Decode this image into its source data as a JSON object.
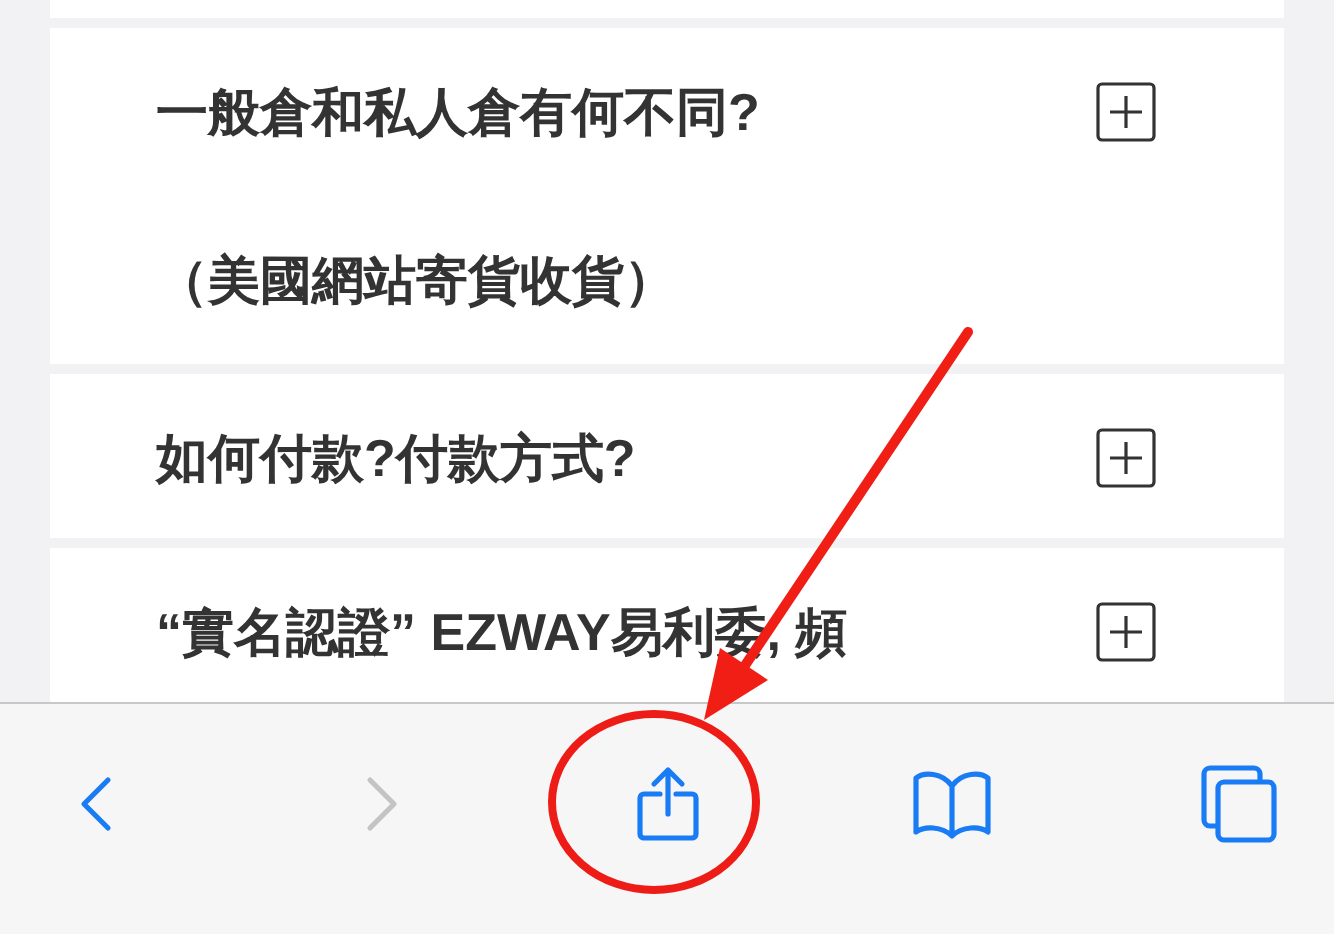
{
  "faq": [
    {
      "lines": [
        "一般倉和私人倉有何不同?",
        "（美國網站寄貨收貨）"
      ],
      "expanded": false
    },
    {
      "lines": [
        "如何付款?付款方式?"
      ],
      "expanded": false
    },
    {
      "lines": [
        "“實名認證” EZWAY易利委, 頻"
      ],
      "expanded": false
    }
  ],
  "toolbar": {
    "buttons": [
      {
        "kind": "back",
        "disabled": false
      },
      {
        "kind": "forward",
        "disabled": true
      },
      {
        "kind": "share",
        "disabled": false,
        "highlighted": true
      },
      {
        "kind": "bookmarks",
        "disabled": false
      },
      {
        "kind": "tabs",
        "disabled": false
      }
    ]
  }
}
